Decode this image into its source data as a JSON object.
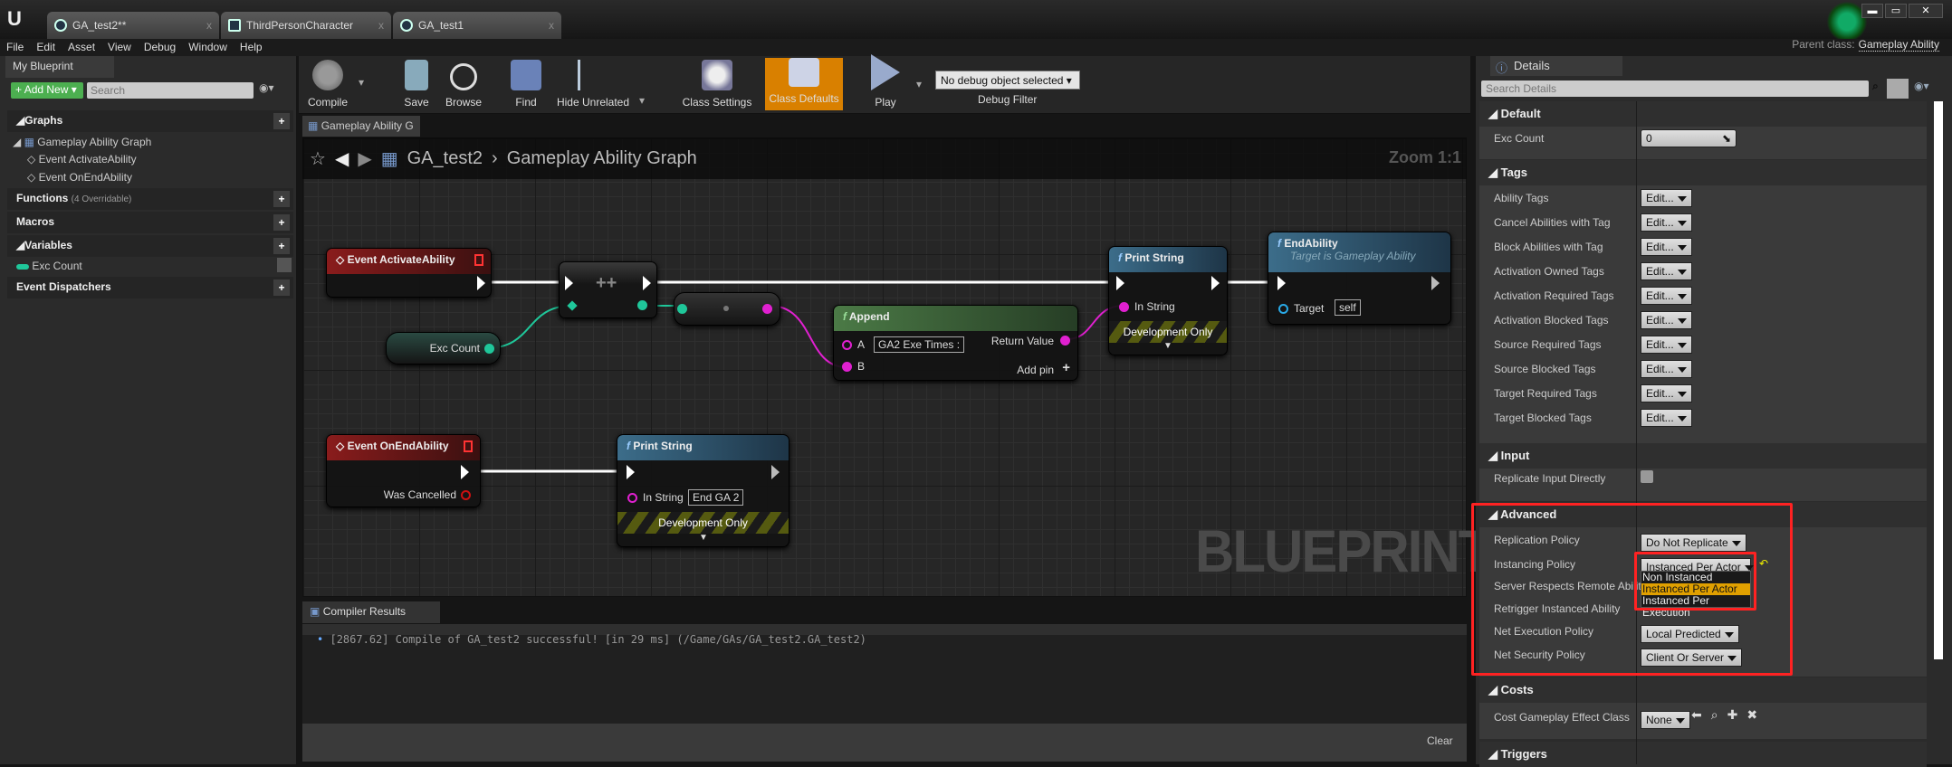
{
  "window": {
    "tabs": [
      {
        "label": "GA_test2**"
      },
      {
        "label": "ThirdPersonCharacter"
      },
      {
        "label": "GA_test1"
      }
    ],
    "parent_class_label": "Parent class:",
    "parent_class": "Gameplay Ability",
    "controls": {
      "minimize": "▬",
      "maximize": "▭",
      "close": "✕"
    }
  },
  "menu": [
    "File",
    "Edit",
    "Asset",
    "View",
    "Debug",
    "Window",
    "Help"
  ],
  "my_blueprint": {
    "tab": "My Blueprint",
    "add_new": "Add New",
    "search_placeholder": "Search",
    "graphs": "Graphs",
    "graph_name": "Gameplay Ability Graph",
    "events": [
      "Event ActivateAbility",
      "Event OnEndAbility"
    ],
    "functions": "Functions",
    "functions_note": "(4 Overridable)",
    "macros": "Macros",
    "variables": "Variables",
    "variable_items": [
      {
        "name": "Exc Count",
        "color": "#1fc79a"
      }
    ],
    "dispatchers": "Event Dispatchers"
  },
  "toolbar": {
    "compile": "Compile",
    "save": "Save",
    "browse": "Browse",
    "find": "Find",
    "hide_unrelated": "Hide Unrelated",
    "class_settings": "Class Settings",
    "class_defaults": "Class Defaults",
    "play": "Play",
    "debug_object": "No debug object selected",
    "debug_filter": "Debug Filter",
    "active_color": "#d98000"
  },
  "graph": {
    "tab": "Gameplay Ability G",
    "breadcrumb_root": "GA_test2",
    "breadcrumb_sep": "›",
    "breadcrumb_leaf": "Gameplay Ability Graph",
    "zoom": "Zoom 1:1",
    "watermark": "BLUEPRINT",
    "nodes": {
      "activate": "Event ActivateAbility",
      "incr": "++",
      "exc_count": "Exc Count",
      "append": "Append",
      "append_a": "A",
      "append_a_value": "GA2 Exe Times :",
      "append_b": "B",
      "return_value": "Return Value",
      "add_pin": "Add pin",
      "print1": "Print String",
      "in_string": "In String",
      "dev_only": "Development Only",
      "end_ability": "EndAbility",
      "end_ability_sub": "Target is Gameplay Ability",
      "target": "Target",
      "target_value": "self",
      "on_end": "Event OnEndAbility",
      "was_cancelled": "Was Cancelled",
      "print2": "Print String",
      "print2_value": "End GA 2"
    }
  },
  "compiler": {
    "tab": "Compiler Results",
    "message": "[2867.62] Compile of GA_test2 successful! [in 29 ms] (/Game/GAs/GA_test2.GA_test2)",
    "clear": "Clear"
  },
  "details": {
    "tab": "Details",
    "search_placeholder": "Search Details",
    "default": "Default",
    "exc_count_label": "Exc Count",
    "exc_count_value": "0",
    "tags": "Tags",
    "tag_rows": [
      "Ability Tags",
      "Cancel Abilities with Tag",
      "Block Abilities with Tag",
      "Activation Owned Tags",
      "Activation Required Tags",
      "Activation Blocked Tags",
      "Source Required Tags",
      "Source Blocked Tags",
      "Target Required Tags",
      "Target Blocked Tags"
    ],
    "edit_label": "Edit...",
    "input": "Input",
    "replicate_input": "Replicate Input Directly",
    "replicate_input_checked": false,
    "advanced": "Advanced",
    "replication_policy": "Replication Policy",
    "replication_value": "Do Not Replicate",
    "instancing_policy": "Instancing Policy",
    "instancing_value": "Instanced Per Actor",
    "instancing_options": [
      "Non Instanced",
      "Instanced Per Actor",
      "Instanced Per Execution"
    ],
    "server_respects": "Server Respects Remote Ability",
    "retrigger": "Retrigger Instanced Ability",
    "net_execution": "Net Execution Policy",
    "net_execution_value": "Local Predicted",
    "net_security": "Net Security Policy",
    "net_security_value": "Client Or Server",
    "costs": "Costs",
    "cost_ge": "Cost Gameplay Effect Class",
    "cost_ge_value": "None",
    "triggers": "Triggers",
    "highlight_color": "#ff2222"
  }
}
